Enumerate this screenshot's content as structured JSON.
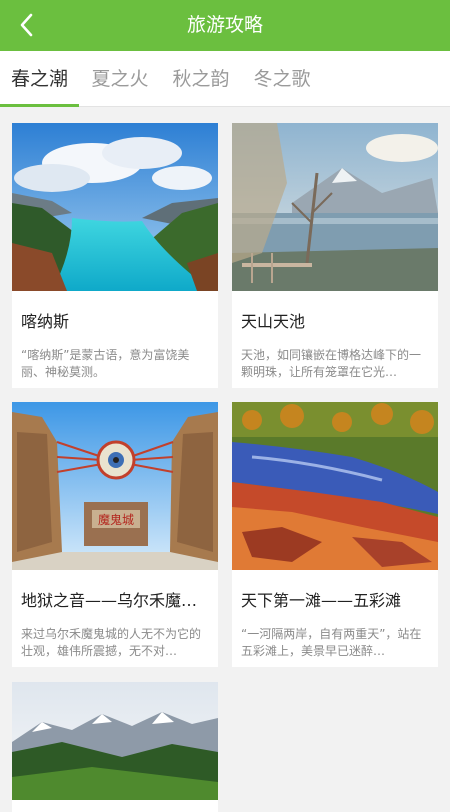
{
  "header": {
    "title": "旅游攻略",
    "back_icon": "chevron-left-icon",
    "color": "#6bbf3f"
  },
  "tabs": [
    {
      "label": "春之潮",
      "active": true
    },
    {
      "label": "夏之火",
      "active": false
    },
    {
      "label": "秋之韵",
      "active": false
    },
    {
      "label": "冬之歌",
      "active": false
    }
  ],
  "cards": [
    {
      "title": "喀纳斯",
      "desc": "“喀纳斯”是蒙古语，意为富饶美丽、神秘莫测。"
    },
    {
      "title": "天山天池",
      "desc": "天池，如同镶嵌在博格达峰下的一颗明珠，让所有笼罩在它光…"
    },
    {
      "title": "地狱之音——乌尔禾魔…",
      "desc": "来过乌尔禾魔鬼城的人无不为它的壮观，雄伟所震撼，无不对…"
    },
    {
      "title": "天下第一滩——五彩滩",
      "desc": "“一河隔两岸，自有两重天”，站在五彩滩上，美景早已迷醉…"
    },
    {
      "title": "",
      "desc": ""
    }
  ],
  "gate_sign": "魔鬼城"
}
